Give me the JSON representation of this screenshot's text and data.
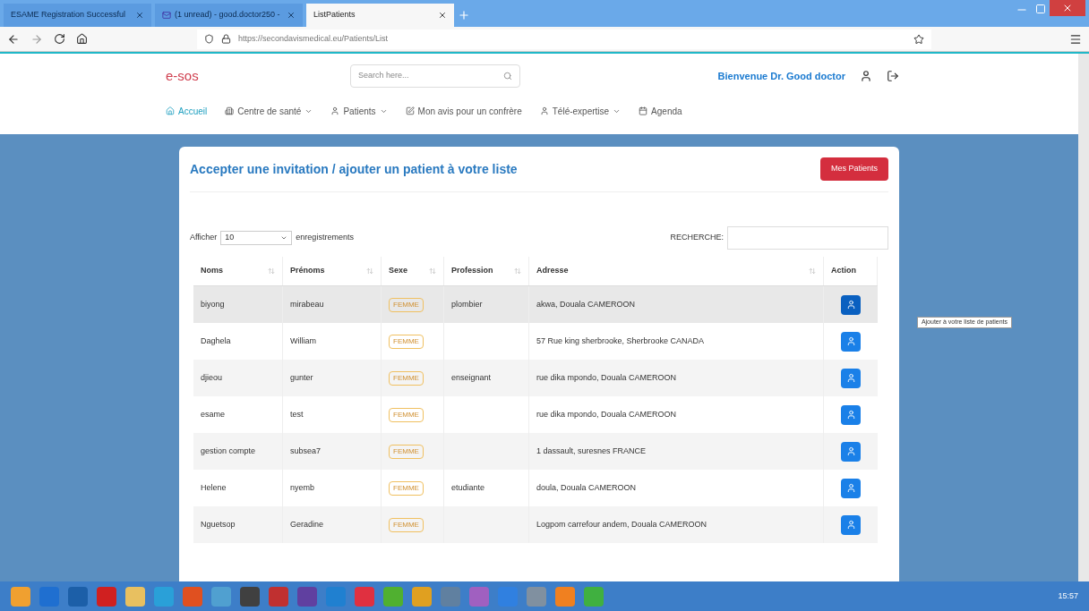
{
  "browser": {
    "tabs": [
      {
        "label": "ESAME Registration Successful",
        "selected": false
      },
      {
        "label": "(1 unread) - good.doctor250 -",
        "selected": false
      },
      {
        "label": "ListPatients",
        "selected": true
      }
    ],
    "url": "https://secondavismedical.eu/Patients/List"
  },
  "header": {
    "logo": "e-sos",
    "search_placeholder": "Search here...",
    "welcome": "Bienvenue Dr. Good doctor"
  },
  "nav": [
    {
      "label": "Accueil",
      "selected": true,
      "dropdown": false
    },
    {
      "label": "Centre de santé",
      "selected": false,
      "dropdown": true
    },
    {
      "label": "Patients",
      "selected": false,
      "dropdown": true
    },
    {
      "label": "Mon avis pour un confrère",
      "selected": false,
      "dropdown": false
    },
    {
      "label": "Télé-expertise",
      "selected": false,
      "dropdown": true
    },
    {
      "label": "Agenda",
      "selected": false,
      "dropdown": false
    }
  ],
  "card": {
    "title": "Accepter une invitation / ajouter un patient à votre liste",
    "button": "Mes Patients",
    "length": {
      "before": "Afficher",
      "value": "10",
      "after": "enregistrements"
    },
    "search_label": "RECHERCHE:"
  },
  "table": {
    "columns": [
      "Noms",
      "Prénoms",
      "Sexe",
      "Profession",
      "Adresse",
      "Action"
    ],
    "rows": [
      {
        "cells": [
          "biyong",
          "mirabeau",
          "FEMME",
          "plombier",
          "akwa, Douala CAMEROON"
        ],
        "hovered": true
      },
      {
        "cells": [
          "Daghela",
          "William",
          "FEMME",
          "",
          "57 Rue king sherbrooke, Sherbrooke CANADA"
        ],
        "hovered": false
      },
      {
        "cells": [
          "djieou",
          "gunter",
          "FEMME",
          "enseignant",
          "rue dika mpondo, Douala CAMEROON"
        ],
        "hovered": false
      },
      {
        "cells": [
          "esame",
          "test",
          "FEMME",
          "",
          "rue dika mpondo, Douala CAMEROON"
        ],
        "hovered": false
      },
      {
        "cells": [
          "gestion compte",
          "subsea7",
          "FEMME",
          "",
          "1 dassault, suresnes FRANCE"
        ],
        "hovered": false
      },
      {
        "cells": [
          "Helene",
          "nyemb",
          "FEMME",
          "etudiante",
          "doula, Douala CAMEROON"
        ],
        "hovered": false
      },
      {
        "cells": [
          "Nguetsop",
          "Geradine",
          "FEMME",
          "",
          "Logpom carrefour andem, Douala CAMEROON"
        ],
        "hovered": false
      }
    ]
  },
  "tooltip": "Ajouter à votre liste de patients",
  "taskbar": {
    "time": "15:57"
  }
}
